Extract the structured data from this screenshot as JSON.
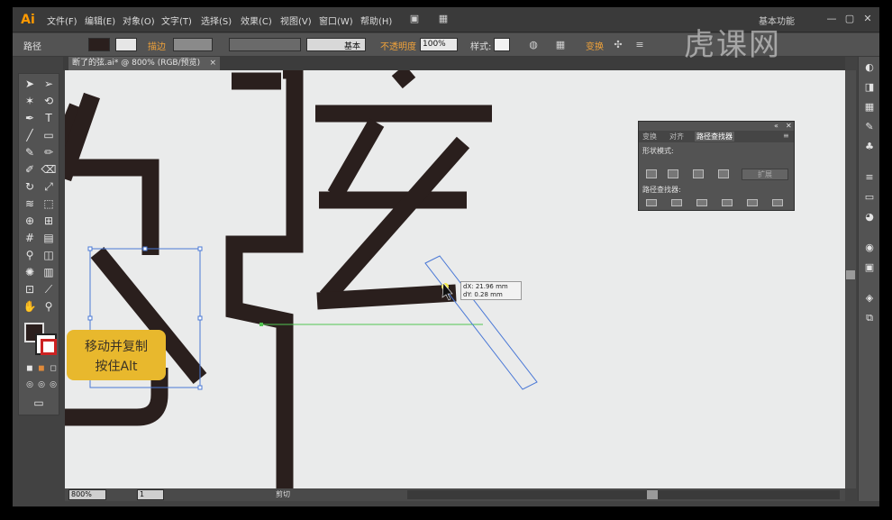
{
  "app": {
    "logo": "Ai",
    "workspace": "基本功能"
  },
  "menu": [
    "文件(F)",
    "编辑(E)",
    "对象(O)",
    "文字(T)",
    "选择(S)",
    "效果(C)",
    "视图(V)",
    "窗口(W)",
    "帮助(H)"
  ],
  "window_buttons": [
    "—",
    "▢",
    "✕"
  ],
  "control": {
    "selection": "路径",
    "stroke_label": "描边",
    "stroke_style": "基本",
    "opacity_label": "不透明度",
    "opacity_value": "100%",
    "style_label": "样式:",
    "transform_label": "变换"
  },
  "document": {
    "tab_title": "断了的弦.ai* @ 800% (RGB/预览)",
    "tab_close": "×"
  },
  "status": {
    "zoom": "800%",
    "artboard": "1",
    "mode": "剪切"
  },
  "pathfinder": {
    "tabs": [
      "变换",
      "对齐",
      "路径查找器"
    ],
    "shape_modes": "形状模式:",
    "expand": "扩展",
    "pathfinders": "路径查找器:"
  },
  "tooltip": {
    "dx": "dX: 21.96 mm",
    "dy": "dY: 0.28 mm"
  },
  "callout": {
    "line1": "移动并复制",
    "line2": "按住Alt"
  },
  "watermark": "虎课网",
  "colors": {
    "ink": "#2a1f1d",
    "selection": "#3b6fd6",
    "guide": "#4fc04f",
    "callout": "#e8b82d",
    "accent": "#ff9a00"
  }
}
